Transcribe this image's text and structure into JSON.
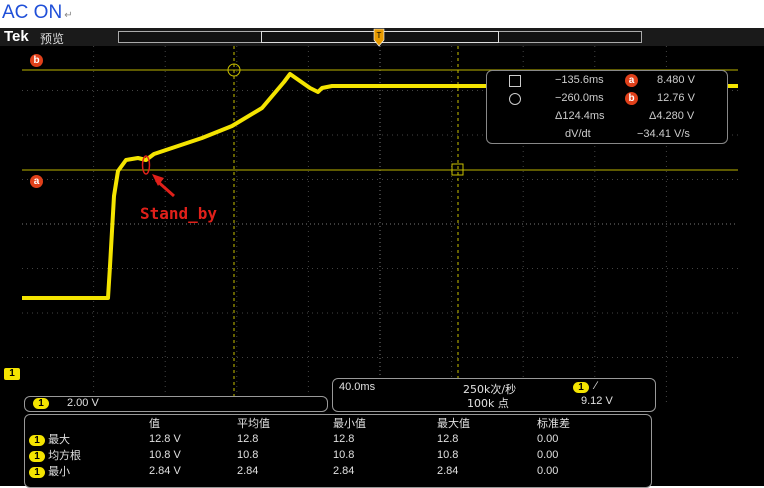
{
  "doc": {
    "title": "AC ON",
    "pilcrow": "↵"
  },
  "scope": {
    "brand": "Tek",
    "mode": "预览",
    "markers": {
      "a": "a",
      "b": "b",
      "ch1": "1"
    },
    "annotation": "Stand_by",
    "cursor_readout": {
      "t1": "−135.6ms",
      "t2": "−260.0ms",
      "dt": "Δ124.4ms",
      "dvdt_label": "dV/dt",
      "va": "8.480 V",
      "vb": "12.76 V",
      "dv": "Δ4.280 V",
      "dvdt": "−34.41 V/s"
    },
    "channel_scale": {
      "chip": "1",
      "value": "2.00 V"
    },
    "acquisition": {
      "timebase": "40.0ms",
      "rate": "250k次/秒",
      "points": "100k 点",
      "trigger_chip": "1",
      "trigger_slope": "∕",
      "trigger_level": "9.12 V"
    },
    "stats": {
      "headers": [
        "值",
        "平均值",
        "最小值",
        "最大值",
        "标准差"
      ],
      "rows": [
        {
          "chip": "1",
          "label": "最大",
          "values": [
            "12.8 V",
            "12.8",
            "12.8",
            "12.8",
            "0.00"
          ]
        },
        {
          "chip": "1",
          "label": "均方根",
          "values": [
            "10.8 V",
            "10.8",
            "10.8",
            "10.8",
            "0.00"
          ]
        },
        {
          "chip": "1",
          "label": "最小",
          "values": [
            "2.84 V",
            "2.84",
            "2.84",
            "2.84",
            "0.00"
          ]
        }
      ]
    },
    "colors": {
      "trace": "#f4e400",
      "cursor": "#e0401a",
      "annotation": "#e0201a"
    }
  }
}
